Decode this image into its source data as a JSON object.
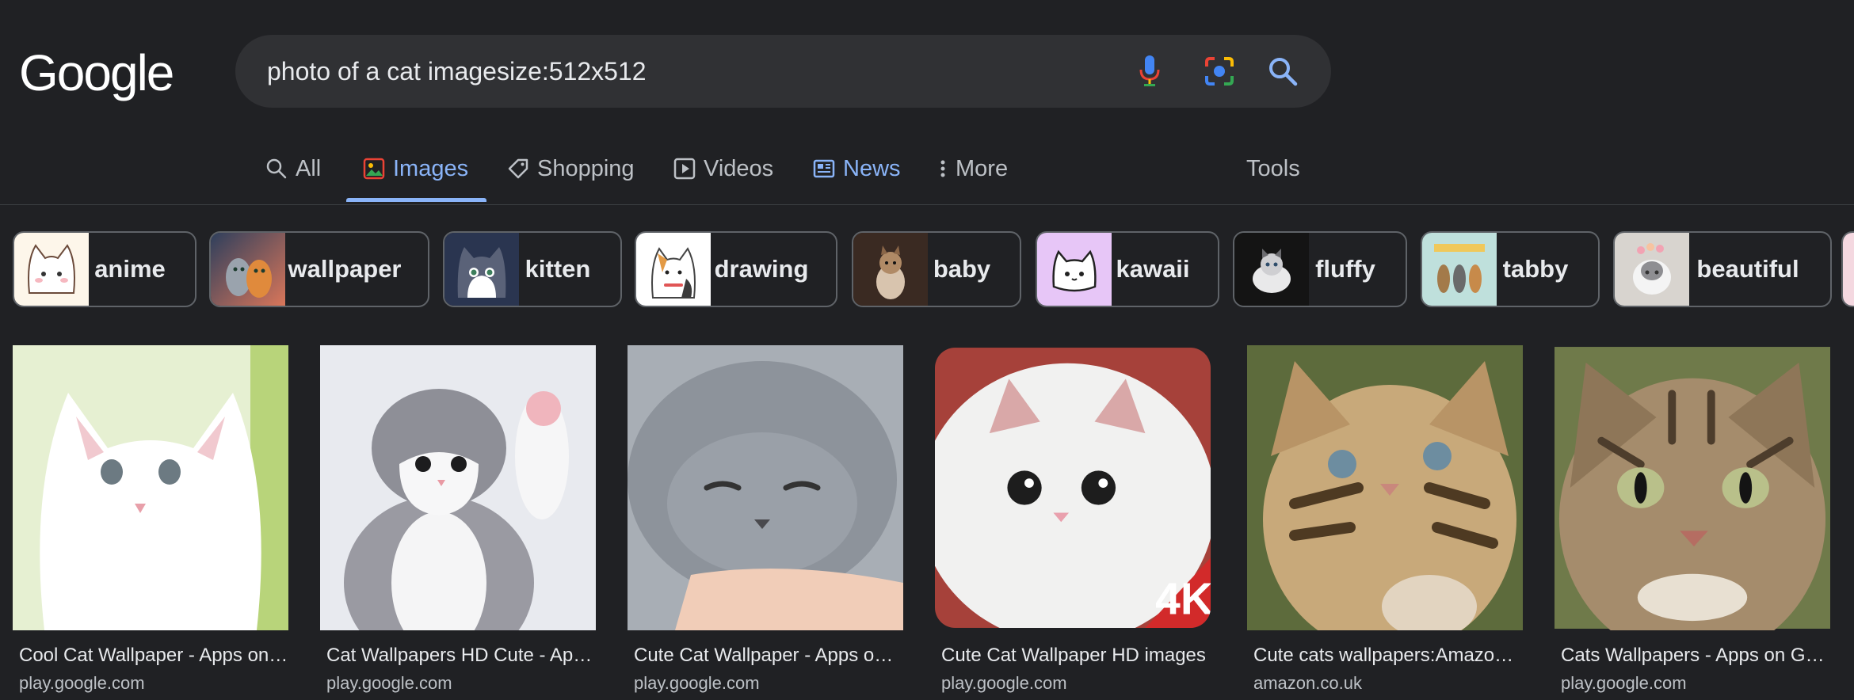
{
  "logo": "Google",
  "search": {
    "query": "photo of a cat imagesize:512x512"
  },
  "tabs": [
    {
      "label": "All",
      "icon": "search-icon"
    },
    {
      "label": "Images",
      "icon": "image-icon"
    },
    {
      "label": "Shopping",
      "icon": "tag-icon"
    },
    {
      "label": "Videos",
      "icon": "play-icon"
    },
    {
      "label": "News",
      "icon": "newspaper-icon"
    },
    {
      "label": "More",
      "icon": "more-vert-icon"
    }
  ],
  "tools_label": "Tools",
  "chips": [
    {
      "label": "anime"
    },
    {
      "label": "wallpaper"
    },
    {
      "label": "kitten"
    },
    {
      "label": "drawing"
    },
    {
      "label": "baby"
    },
    {
      "label": "kawaii"
    },
    {
      "label": "fluffy"
    },
    {
      "label": "tabby"
    },
    {
      "label": "beautiful"
    }
  ],
  "results": [
    {
      "title": "Cool Cat Wallpaper - Apps on Google Play",
      "source": "play.google.com"
    },
    {
      "title": "Cat Wallpapers HD Cute - Apps on Google Play",
      "source": "play.google.com"
    },
    {
      "title": "Cute Cat Wallpaper - Apps on Google Play",
      "source": "play.google.com"
    },
    {
      "title": "Cute Cat Wallpaper HD images",
      "source": "play.google.com",
      "badge": "4K"
    },
    {
      "title": "Cute cats wallpapers:Amazon.co.uk",
      "source": "amazon.co.uk"
    },
    {
      "title": "Cats Wallpapers - Apps on Google Play",
      "source": "play.google.com"
    }
  ],
  "colors": {
    "background": "#202124",
    "accent": "#8ab4f8",
    "search_bg": "#303134",
    "chip_border": "#5f6368"
  }
}
